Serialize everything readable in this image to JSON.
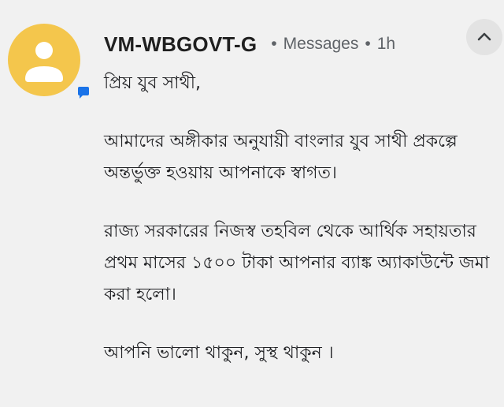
{
  "notification": {
    "sender": "VM-WBGOVT-G",
    "separator": "•",
    "app_name": "Messages",
    "time": "1h",
    "avatar_icon": "person-icon",
    "badge_icon": "messages-app-icon",
    "expand_icon": "chevron-up-icon",
    "colors": {
      "avatar_bg": "#f4c64c",
      "badge": "#1a73e8",
      "background": "#f1f1f1"
    }
  },
  "message": {
    "paragraphs": [
      "প্রিয় যুব সাথী,",
      "আমাদের অঙ্গীকার অনুযায়ী বাংলার যুব সাথী প্রকল্পে অন্তর্ভুক্ত হওয়ায় আপনাকে স্বাগত।",
      "রাজ্য সরকারের নিজস্ব তহবিল থেকে আর্থিক সহায়তার প্রথম মাসের ১৫০০ টাকা আপনার ব্যাঙ্ক অ্যাকাউন্টে জমা করা হলো।",
      "আপনি ভালো থাকুন, সুস্থ থাকুন ।"
    ]
  }
}
